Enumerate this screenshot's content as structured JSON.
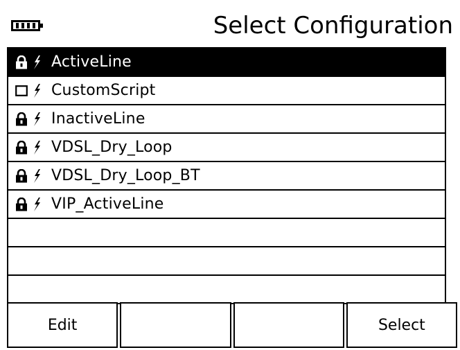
{
  "header": {
    "title": "Select Configuration",
    "battery_icon": "battery-full-icon"
  },
  "list": {
    "items": [
      {
        "label": "ActiveLine",
        "lock": "locked",
        "selected": true
      },
      {
        "label": "CustomScript",
        "lock": "unlocked",
        "selected": false
      },
      {
        "label": "InactiveLine",
        "lock": "locked",
        "selected": false
      },
      {
        "label": "VDSL_Dry_Loop",
        "lock": "locked",
        "selected": false
      },
      {
        "label": "VDSL_Dry_Loop_BT",
        "lock": "locked",
        "selected": false
      },
      {
        "label": "VIP_ActiveLine",
        "lock": "locked",
        "selected": false
      }
    ],
    "empty_rows": 3
  },
  "softkeys": [
    {
      "label": "Edit"
    },
    {
      "label": ""
    },
    {
      "label": ""
    },
    {
      "label": "Select"
    }
  ],
  "colors": {
    "background": "#ffffff",
    "foreground": "#000000",
    "selection": "#000000"
  }
}
